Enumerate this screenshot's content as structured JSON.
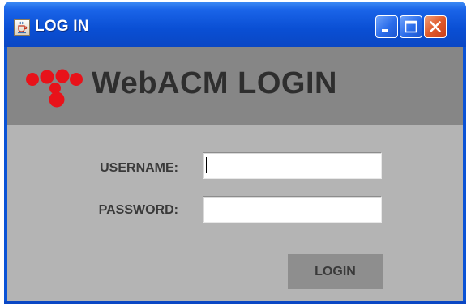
{
  "window": {
    "title": "LOG IN",
    "app_icon": "java-cup-icon",
    "controls": [
      "minimize-icon",
      "maximize-icon",
      "close-icon"
    ]
  },
  "banner": {
    "logo_icon": "red-dots-logo",
    "heading": "WebACM LOGIN"
  },
  "form": {
    "username_label": "USERNAME:",
    "username_value": "",
    "password_label": "PASSWORD:",
    "password_value": "",
    "login_label": "LOGIN"
  },
  "colors": {
    "title_bar": "#0a53d6",
    "banner_bg": "#868686",
    "panel_bg": "#b4b4b4",
    "logo_red": "#e8121a",
    "button_bg": "#8e8e8e"
  }
}
